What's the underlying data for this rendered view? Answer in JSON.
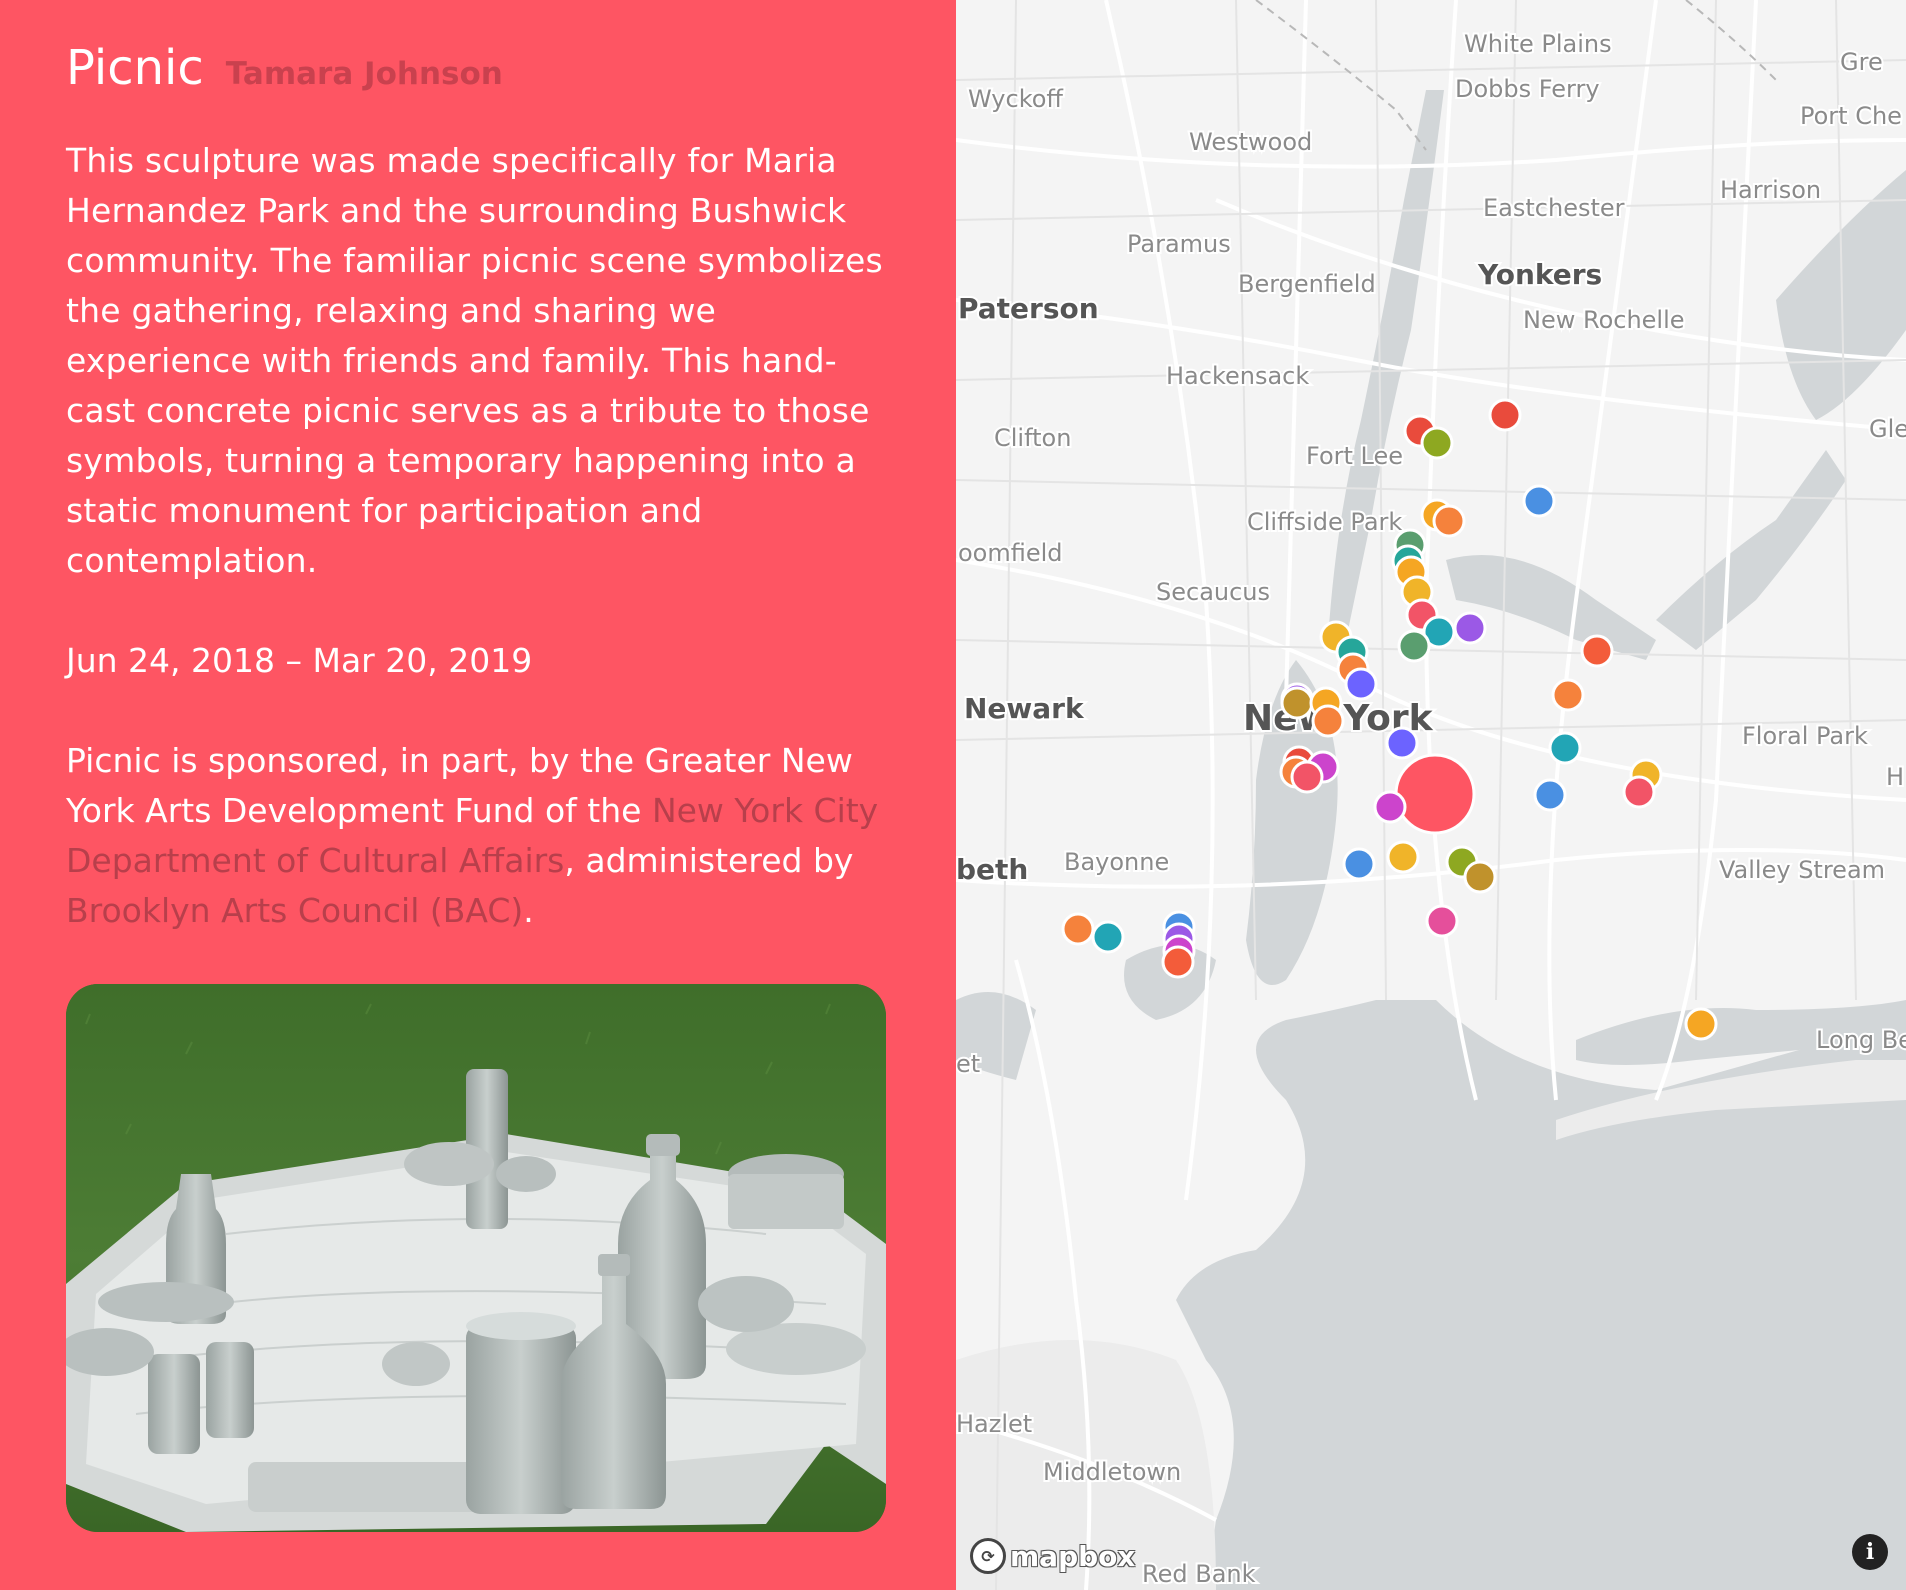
{
  "panel": {
    "title": "Picnic",
    "artist": "Tamara Johnson",
    "description": "This sculpture was made specifically for Maria Hernandez Park and the surrounding Bushwick community. The familiar picnic scene symbolizes the gathering, relaxing and sharing we experience with friends and family. This hand-cast concrete picnic serves as a tribute to those symbols, turning a temporary happening into a static monument for participation and contemplation.",
    "dates": "Jun 24, 2018 – Mar 20, 2019",
    "sponsor": {
      "prefix": "Picnic is sponsored, in part, by the Greater New York Arts Development Fund of the ",
      "link1": "New York City Department of Cultural Affairs",
      "middle": ", administered by ",
      "link2": "Brooklyn Arts Council (BAC)",
      "suffix": "."
    },
    "colors": {
      "background": "#fe5563",
      "text": "#ffffff",
      "artist": "#c9414e",
      "link": "#b83f4b"
    }
  },
  "map": {
    "provider_logo": "mapbox",
    "info_button": "i",
    "place_labels": [
      {
        "text": "White Plains",
        "size": "medium"
      },
      {
        "text": "Gre",
        "size": "medium"
      },
      {
        "text": "Wyckoff",
        "size": "medium"
      },
      {
        "text": "Dobbs Ferry",
        "size": "medium"
      },
      {
        "text": "Port Che",
        "size": "medium"
      },
      {
        "text": "Westwood",
        "size": "medium"
      },
      {
        "text": "Harrison",
        "size": "medium"
      },
      {
        "text": "Eastchester",
        "size": "medium"
      },
      {
        "text": "Paramus",
        "size": "medium"
      },
      {
        "text": "Yonkers",
        "size": "large"
      },
      {
        "text": "Bergenfield",
        "size": "medium"
      },
      {
        "text": "Paterson",
        "size": "large"
      },
      {
        "text": "New Rochelle",
        "size": "medium"
      },
      {
        "text": "Hackensack",
        "size": "medium"
      },
      {
        "text": "Clifton",
        "size": "medium"
      },
      {
        "text": "Gle",
        "size": "medium"
      },
      {
        "text": "Fort Lee",
        "size": "medium"
      },
      {
        "text": "Cliffside Park",
        "size": "medium"
      },
      {
        "text": "oomfield",
        "size": "medium"
      },
      {
        "text": "Secaucus",
        "size": "medium"
      },
      {
        "text": "Newark",
        "size": "large"
      },
      {
        "text": "New York",
        "size": "xlarge"
      },
      {
        "text": "Floral Park",
        "size": "medium"
      },
      {
        "text": "H",
        "size": "medium"
      },
      {
        "text": "beth",
        "size": "large"
      },
      {
        "text": "Bayonne",
        "size": "medium"
      },
      {
        "text": "Valley Stream",
        "size": "medium"
      },
      {
        "text": "Long Be",
        "size": "medium"
      },
      {
        "text": "et",
        "size": "medium"
      },
      {
        "text": "Hazlet",
        "size": "medium"
      },
      {
        "text": "Middletown",
        "size": "medium"
      },
      {
        "text": "Red Bank",
        "size": "medium"
      }
    ],
    "markers": [
      {
        "color": "#e94b3c",
        "selected": false
      },
      {
        "color": "#e94b3c",
        "selected": false
      },
      {
        "color": "#8ea821",
        "selected": false
      },
      {
        "color": "#4a90e2",
        "selected": false
      },
      {
        "color": "#f5a623",
        "selected": false
      },
      {
        "color": "#f5823c",
        "selected": false
      },
      {
        "color": "#5a9e6f",
        "selected": false
      },
      {
        "color": "#26a69a",
        "selected": false
      },
      {
        "color": "#f5a623",
        "selected": false
      },
      {
        "color": "#f0b429",
        "selected": false
      },
      {
        "color": "#f25467",
        "selected": false
      },
      {
        "color": "#22a5b5",
        "selected": false
      },
      {
        "color": "#9b59e6",
        "selected": false
      },
      {
        "color": "#5a9e6f",
        "selected": false
      },
      {
        "color": "#f0b429",
        "selected": false
      },
      {
        "color": "#26a69a",
        "selected": false
      },
      {
        "color": "#f5823c",
        "selected": false
      },
      {
        "color": "#6c63ff",
        "selected": false
      },
      {
        "color": "#f35c3a",
        "selected": false
      },
      {
        "color": "#f5823c",
        "selected": false
      },
      {
        "color": "#9b59e6",
        "selected": false
      },
      {
        "color": "#c0922c",
        "selected": false
      },
      {
        "color": "#f5a623",
        "selected": false
      },
      {
        "color": "#f5823c",
        "selected": false
      },
      {
        "color": "#6c63ff",
        "selected": false
      },
      {
        "color": "#22a5b5",
        "selected": false
      },
      {
        "color": "#e94b3c",
        "selected": false
      },
      {
        "color": "#cc44cc",
        "selected": false
      },
      {
        "color": "#f5823c",
        "selected": false
      },
      {
        "color": "#f25467",
        "selected": false
      },
      {
        "color": "#26a69a",
        "selected": false
      },
      {
        "color": "#fe5563",
        "selected": true
      },
      {
        "color": "#cc44cc",
        "selected": false
      },
      {
        "color": "#4a90e2",
        "selected": false
      },
      {
        "color": "#f0b429",
        "selected": false
      },
      {
        "color": "#f25467",
        "selected": false
      },
      {
        "color": "#4a90e2",
        "selected": false
      },
      {
        "color": "#f0b429",
        "selected": false
      },
      {
        "color": "#8ea821",
        "selected": false
      },
      {
        "color": "#c0922c",
        "selected": false
      },
      {
        "color": "#e54f9b",
        "selected": false
      },
      {
        "color": "#f5823c",
        "selected": false
      },
      {
        "color": "#22a5b5",
        "selected": false
      },
      {
        "color": "#4a90e2",
        "selected": false
      },
      {
        "color": "#9b59e6",
        "selected": false
      },
      {
        "color": "#cc44cc",
        "selected": false
      },
      {
        "color": "#f35c3a",
        "selected": false
      },
      {
        "color": "#f5a623",
        "selected": false
      }
    ]
  }
}
